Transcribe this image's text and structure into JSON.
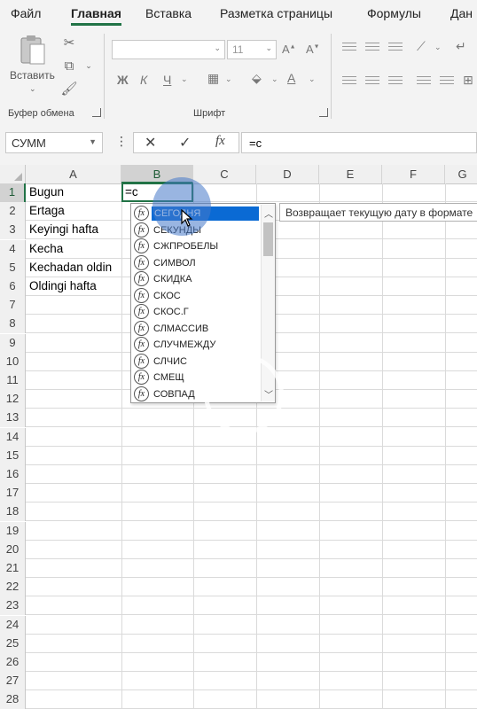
{
  "ribbon": {
    "tabs": [
      "Файл",
      "Главная",
      "Вставка",
      "Разметка страницы",
      "Формулы",
      "Дан"
    ],
    "active_tab": "Главная",
    "clipboard": {
      "paste_label": "Вставить",
      "group_label": "Буфер обмена"
    },
    "font": {
      "font_name": "",
      "font_size": "11",
      "bold": "Ж",
      "italic": "К",
      "underline": "Ч",
      "font_color_letter": "А",
      "group_label": "Шрифт"
    }
  },
  "formula_bar": {
    "name_box": "СУММ",
    "fx_label": "fx",
    "formula": "=c"
  },
  "grid": {
    "columns": [
      "A",
      "B",
      "C",
      "D",
      "E",
      "F",
      "G"
    ],
    "selected_column": "B",
    "rows": [
      "1",
      "2",
      "3",
      "4",
      "5",
      "6",
      "7",
      "8",
      "9",
      "10",
      "11",
      "12",
      "13",
      "14",
      "15",
      "16",
      "17",
      "18",
      "19",
      "20",
      "21",
      "22",
      "23",
      "24",
      "25",
      "26",
      "27",
      "28"
    ],
    "selected_row": "1",
    "column_a_values": [
      "Bugun",
      "Ertaga",
      "Keyingi hafta",
      "Kecha",
      "Kechadan oldin",
      "Oldingi hafta"
    ],
    "active_cell_value": "=c"
  },
  "autocomplete": {
    "items": [
      "СЕГОДНЯ",
      "СЕКУНДЫ",
      "СЖПРОБЕЛЫ",
      "СИМВОЛ",
      "СКИДКА",
      "СКОС",
      "СКОС.Г",
      "СЛМАССИВ",
      "СЛУЧМЕЖДУ",
      "СЛЧИС",
      "СМЕЩ",
      "СОВПАД"
    ],
    "selected_index": 0,
    "fx_glyph": "fx",
    "tooltip": "Возвращает текущую дату в формате"
  },
  "colors": {
    "accent": "#217346",
    "selection": "#0a6ad4"
  }
}
